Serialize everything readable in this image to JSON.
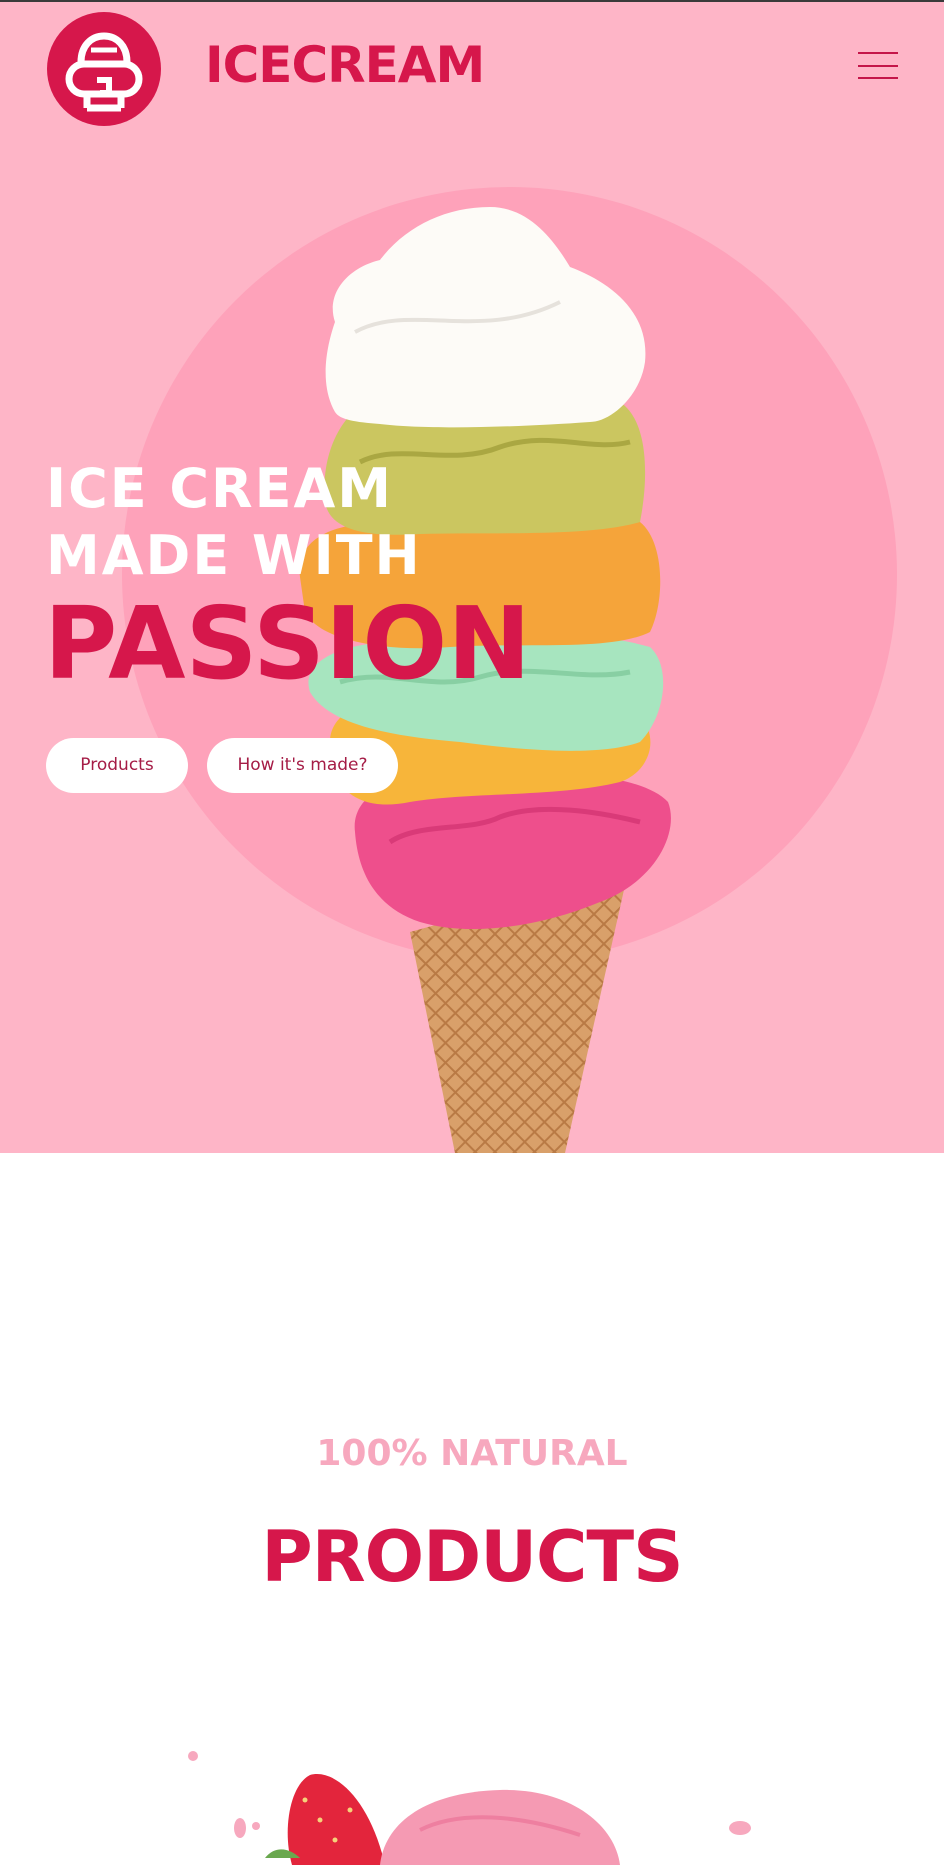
{
  "header": {
    "brand": "ICECREAM",
    "logo_icon": "ice-cream-logo-icon",
    "menu_icon": "hamburger-menu-icon"
  },
  "hero": {
    "line1": "ICE CREAM",
    "line2": "MADE WITH",
    "line3": "PASSION",
    "buttons": [
      {
        "label": "Products"
      },
      {
        "label": "How it's made?"
      }
    ]
  },
  "products_section": {
    "subtitle": "100% NATURAL",
    "title": "PRODUCTS"
  },
  "colors": {
    "hero_bg": "#feb5c7",
    "circle": "#fea2ba",
    "accent": "#d6174b",
    "subtitle": "#f7a8be"
  }
}
